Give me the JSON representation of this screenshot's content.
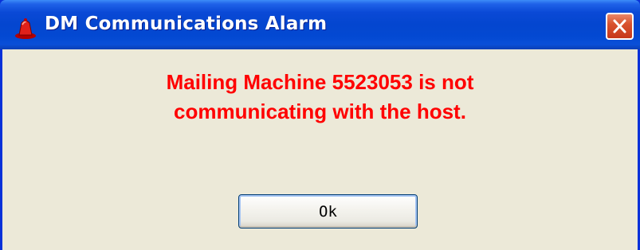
{
  "window": {
    "title": "DM Communications Alarm",
    "title_icon": "alarm-bell-icon",
    "close_icon": "close-icon"
  },
  "message": {
    "line1": "Mailing Machine 5523053 is not",
    "line2": "communicating with the host."
  },
  "buttons": {
    "ok_label": "Ok"
  },
  "colors": {
    "titlebar": "#0a49d6",
    "message_text": "#ff0000",
    "dialog_background": "#ece9d8",
    "close_button": "#d9532f"
  }
}
